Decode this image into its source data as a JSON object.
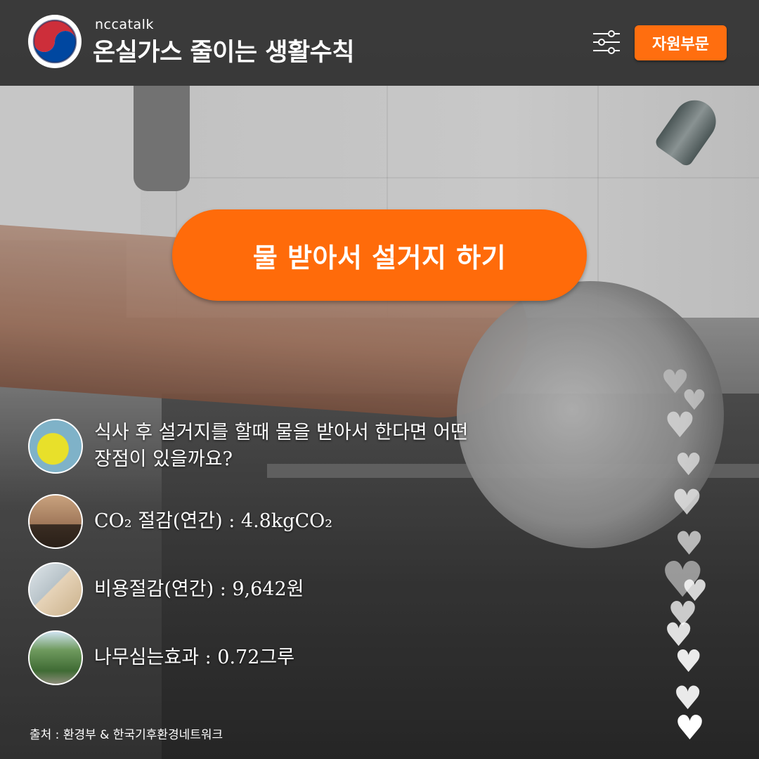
{
  "header": {
    "subtitle": "nccatalk",
    "title": "온실가스 줄이는 생활수칙",
    "category_button": "자원부문"
  },
  "headline": "물 받아서 설거지 하기",
  "question": "식사 후 설거지를 할때 물을 받아서 한다면 어떤 장점이 있을까요?",
  "facts": [
    {
      "icon": "co2-factory-icon",
      "text": "CO₂ 절감(연간) : 4.8kgCO₂"
    },
    {
      "icon": "calculator-money-icon",
      "text": "비용절감(연간) : 9,642원"
    },
    {
      "icon": "forest-tree-icon",
      "text": "나무심는효과 : 0.72그루"
    }
  ],
  "source": "출처 : 환경부 & 한국기후환경네트워크",
  "colors": {
    "accent": "#ff6b0a",
    "header_bg": "#303030",
    "text": "#ffffff"
  }
}
